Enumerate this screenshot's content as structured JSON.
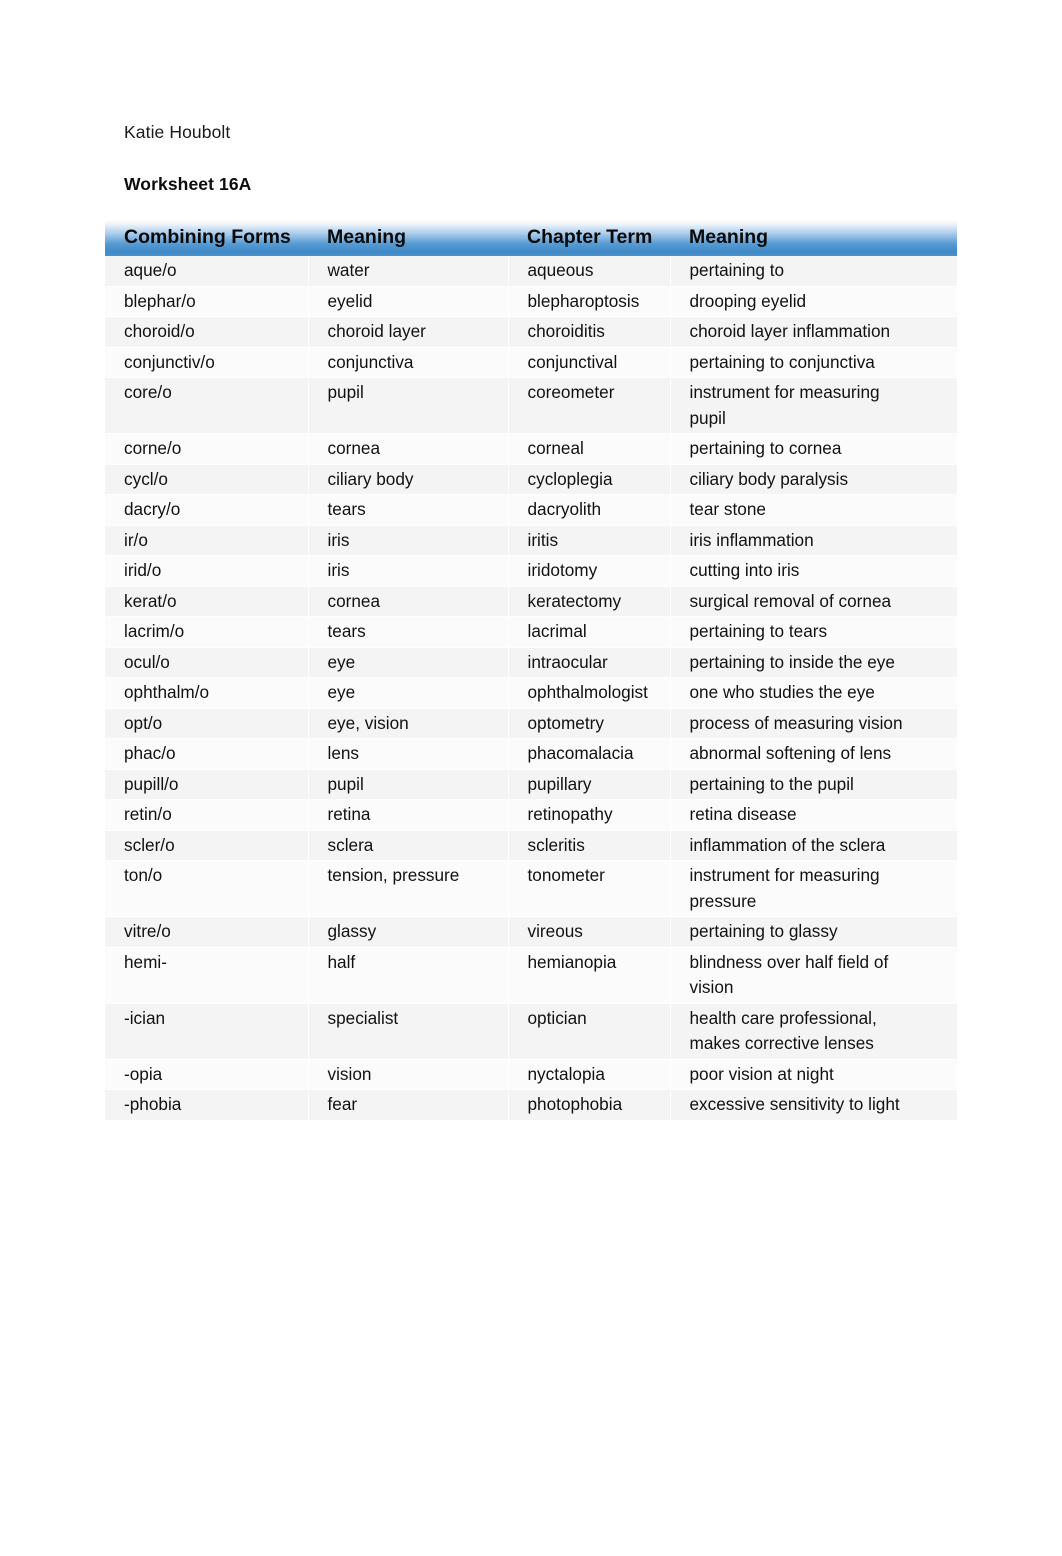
{
  "document": {
    "author": "Katie Houbolt",
    "title": "Worksheet 16A"
  },
  "table": {
    "headers": [
      "Combining Forms",
      "Meaning",
      "Chapter Term",
      "Meaning"
    ],
    "accent_color": "#4a8fcc",
    "rows": [
      {
        "form": "aque/o",
        "form_meaning": "water",
        "term": "aqueous",
        "term_meaning": "pertaining to"
      },
      {
        "form": "blephar/o",
        "form_meaning": "eyelid",
        "term": "blepharoptosis",
        "term_meaning": "drooping eyelid"
      },
      {
        "form": "choroid/o",
        "form_meaning": "choroid layer",
        "term": "choroiditis",
        "term_meaning": "choroid layer inflammation"
      },
      {
        "form": "conjunctiv/o",
        "form_meaning": "conjunctiva",
        "term": "conjunctival",
        "term_meaning": "pertaining to conjunctiva"
      },
      {
        "form": "core/o",
        "form_meaning": "pupil",
        "term": "coreometer",
        "term_meaning": "instrument for measuring",
        "term_meaning_line2": "pupil",
        "tall": true
      },
      {
        "form": "corne/o",
        "form_meaning": "cornea",
        "term": "corneal",
        "term_meaning": "pertaining to cornea"
      },
      {
        "form": "cycl/o",
        "form_meaning": "ciliary body",
        "term": "cycloplegia",
        "term_meaning": "ciliary body paralysis"
      },
      {
        "form": "dacry/o",
        "form_meaning": "tears",
        "term": "dacryolith",
        "term_meaning": "tear stone"
      },
      {
        "form": "ir/o",
        "form_meaning": "iris",
        "term": "iritis",
        "term_meaning": "iris inflammation"
      },
      {
        "form": "irid/o",
        "form_meaning": "iris",
        "term": "iridotomy",
        "term_meaning": "cutting into iris"
      },
      {
        "form": "kerat/o",
        "form_meaning": "cornea",
        "term": "keratectomy",
        "term_meaning": "surgical removal of cornea"
      },
      {
        "form": "lacrim/o",
        "form_meaning": "tears",
        "term": "lacrimal",
        "term_meaning": "pertaining to tears"
      },
      {
        "form": "ocul/o",
        "form_meaning": "eye",
        "term": "intraocular",
        "term_meaning": "pertaining to inside the eye"
      },
      {
        "form": "ophthalm/o",
        "form_meaning": "eye",
        "term": "ophthalmologist",
        "term_meaning": "one who studies the eye"
      },
      {
        "form": "opt/o",
        "form_meaning": "eye, vision",
        "term": "optometry",
        "term_meaning": "process of measuring vision"
      },
      {
        "form": "phac/o",
        "form_meaning": "lens",
        "term": "phacomalacia",
        "term_meaning": "abnormal softening of lens"
      },
      {
        "form": "pupill/o",
        "form_meaning": "pupil",
        "term": "pupillary",
        "term_meaning": "pertaining to the pupil"
      },
      {
        "form": "retin/o",
        "form_meaning": "retina",
        "term": "retinopathy",
        "term_meaning": "retina disease"
      },
      {
        "form": "scler/o",
        "form_meaning": "sclera",
        "term": "scleritis",
        "term_meaning": "inflammation of the sclera"
      },
      {
        "form": "ton/o",
        "form_meaning": "tension, pressure",
        "term": "tonometer",
        "term_meaning": "instrument for measuring",
        "term_meaning_line2": "pressure",
        "tall": true
      },
      {
        "form": "vitre/o",
        "form_meaning": "glassy",
        "term": "vireous",
        "term_meaning": "pertaining to glassy"
      },
      {
        "form": "hemi-",
        "form_meaning": "half",
        "term": "hemianopia",
        "term_meaning": "blindness over half field of",
        "term_meaning_line2": "vision",
        "tall": true
      },
      {
        "form": "-ician",
        "form_meaning": "specialist",
        "term": "optician",
        "term_meaning": "health care professional,",
        "term_meaning_line2": "makes corrective lenses",
        "tall": true
      },
      {
        "form": "-opia",
        "form_meaning": "vision",
        "term": "nyctalopia",
        "term_meaning": "poor vision at night"
      },
      {
        "form": "-phobia",
        "form_meaning": "fear",
        "term": "photophobia",
        "term_meaning": "excessive sensitivity to light"
      }
    ]
  }
}
